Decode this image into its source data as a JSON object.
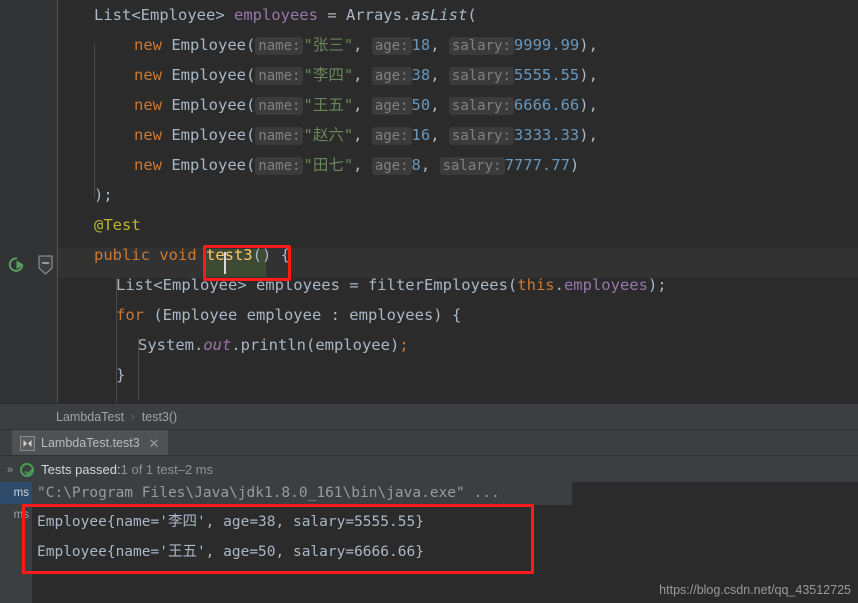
{
  "editor": {
    "code_lines": [
      {
        "indent": 36,
        "tokens": [
          {
            "t": "List<Employee> ",
            "c": "def"
          },
          {
            "t": "employees",
            "c": "fieldref"
          },
          {
            "t": " = Arrays.",
            "c": "def"
          },
          {
            "t": "asList",
            "c": "italic"
          },
          {
            "t": "(",
            "c": "def"
          }
        ]
      },
      {
        "indent": 76,
        "tokens": [
          {
            "t": "new ",
            "c": "kw"
          },
          {
            "t": "Employee(",
            "c": "def"
          },
          {
            "t": "name:",
            "c": "hint"
          },
          {
            "t": "\"张三\"",
            "c": "str"
          },
          {
            "t": ", ",
            "c": "def"
          },
          {
            "t": "age:",
            "c": "hint"
          },
          {
            "t": "18",
            "c": "num"
          },
          {
            "t": ", ",
            "c": "def"
          },
          {
            "t": "salary:",
            "c": "hint"
          },
          {
            "t": "9999.99",
            "c": "num"
          },
          {
            "t": "),",
            "c": "def"
          }
        ]
      },
      {
        "indent": 76,
        "tokens": [
          {
            "t": "new ",
            "c": "kw"
          },
          {
            "t": "Employee(",
            "c": "def"
          },
          {
            "t": "name:",
            "c": "hint"
          },
          {
            "t": "\"李四\"",
            "c": "str"
          },
          {
            "t": ", ",
            "c": "def"
          },
          {
            "t": "age:",
            "c": "hint"
          },
          {
            "t": "38",
            "c": "num"
          },
          {
            "t": ", ",
            "c": "def"
          },
          {
            "t": "salary:",
            "c": "hint"
          },
          {
            "t": "5555.55",
            "c": "num"
          },
          {
            "t": "),",
            "c": "def"
          }
        ]
      },
      {
        "indent": 76,
        "tokens": [
          {
            "t": "new ",
            "c": "kw"
          },
          {
            "t": "Employee(",
            "c": "def"
          },
          {
            "t": "name:",
            "c": "hint"
          },
          {
            "t": "\"王五\"",
            "c": "str"
          },
          {
            "t": ", ",
            "c": "def"
          },
          {
            "t": "age:",
            "c": "hint"
          },
          {
            "t": "50",
            "c": "num"
          },
          {
            "t": ", ",
            "c": "def"
          },
          {
            "t": "salary:",
            "c": "hint"
          },
          {
            "t": "6666.66",
            "c": "num"
          },
          {
            "t": "),",
            "c": "def"
          }
        ]
      },
      {
        "indent": 76,
        "tokens": [
          {
            "t": "new ",
            "c": "kw"
          },
          {
            "t": "Employee(",
            "c": "def"
          },
          {
            "t": "name:",
            "c": "hint"
          },
          {
            "t": "\"赵六\"",
            "c": "str"
          },
          {
            "t": ", ",
            "c": "def"
          },
          {
            "t": "age:",
            "c": "hint"
          },
          {
            "t": "16",
            "c": "num"
          },
          {
            "t": ", ",
            "c": "def"
          },
          {
            "t": "salary:",
            "c": "hint"
          },
          {
            "t": "3333.33",
            "c": "num"
          },
          {
            "t": "),",
            "c": "def"
          }
        ]
      },
      {
        "indent": 76,
        "tokens": [
          {
            "t": "new ",
            "c": "kw"
          },
          {
            "t": "Employee(",
            "c": "def"
          },
          {
            "t": "name:",
            "c": "hint"
          },
          {
            "t": "\"田七\"",
            "c": "str"
          },
          {
            "t": ", ",
            "c": "def"
          },
          {
            "t": "age:",
            "c": "hint"
          },
          {
            "t": "8",
            "c": "num"
          },
          {
            "t": ", ",
            "c": "def"
          },
          {
            "t": "salary:",
            "c": "hint"
          },
          {
            "t": "7777.77",
            "c": "num"
          },
          {
            "t": ")",
            "c": "def"
          }
        ]
      },
      {
        "indent": 36,
        "tokens": [
          {
            "t": ");",
            "c": "def"
          }
        ]
      },
      {
        "indent": 36,
        "tokens": [
          {
            "t": "@Test",
            "c": "anno"
          }
        ]
      },
      {
        "indent": 36,
        "tokens": [
          {
            "t": "public void ",
            "c": "kw"
          },
          {
            "t": "test3",
            "c": "method"
          },
          {
            "t": "()",
            "c": "def"
          },
          {
            "t": " {",
            "c": "def"
          }
        ]
      },
      {
        "indent": 58,
        "tokens": [
          {
            "t": "List<Employee> employees = filterEmployees(",
            "c": "def"
          },
          {
            "t": "this",
            "c": "kw"
          },
          {
            "t": ".",
            "c": "def"
          },
          {
            "t": "employees",
            "c": "fieldref"
          },
          {
            "t": ");",
            "c": "def"
          }
        ]
      },
      {
        "indent": 58,
        "tokens": [
          {
            "t": "for ",
            "c": "kw"
          },
          {
            "t": "(Employee employee : employees) {",
            "c": "def"
          }
        ]
      },
      {
        "indent": 80,
        "tokens": [
          {
            "t": "System.",
            "c": "def"
          },
          {
            "t": "out",
            "c": "static"
          },
          {
            "t": ".println(employee)",
            "c": "def"
          },
          {
            "t": ";",
            "c": "kw"
          }
        ]
      },
      {
        "indent": 58,
        "tokens": [
          {
            "t": "}",
            "c": "def"
          }
        ]
      }
    ],
    "caret_method_name": "test3",
    "run_icon_name": "run-test-gutter-icon",
    "fold_icon_name": "code-fold-collapse-icon"
  },
  "breadcrumb": {
    "class_name": "LambdaTest",
    "separator": "›",
    "method_name": "test3()"
  },
  "test_tab": {
    "label": "LambdaTest.test3",
    "close": "✕",
    "icon_name": "rerun-test-icon"
  },
  "status": {
    "expand_chevrons": "»",
    "prefix": "Tests passed: ",
    "count": "1 of 1 test",
    "dash": " – ",
    "duration": "2 ms"
  },
  "test_tree": {
    "rows": [
      {
        "label": "ms",
        "selected": true
      },
      {
        "label": "ms",
        "selected": false
      }
    ]
  },
  "console": {
    "command_line": "\"C:\\Program Files\\Java\\jdk1.8.0_161\\bin\\java.exe\" ...",
    "output_lines": [
      "Employee{name='李四', age=38, salary=5555.55}",
      "Employee{name='王五', age=50, salary=6666.66}"
    ]
  },
  "watermark": "https://blog.csdn.net/qq_43512725",
  "colors": {
    "editor_bg": "#2b2b2b",
    "panel_bg": "#3c3f41",
    "gutter_bg": "#313335",
    "highlight_box": "#ff1a1a",
    "keyword": "#cc7832",
    "string": "#6a8759",
    "number": "#6897bb",
    "field": "#9876aa",
    "annotation": "#bbb529",
    "method": "#ffc66d",
    "default_text": "#a9b7c6",
    "pass_green": "#499c54"
  }
}
